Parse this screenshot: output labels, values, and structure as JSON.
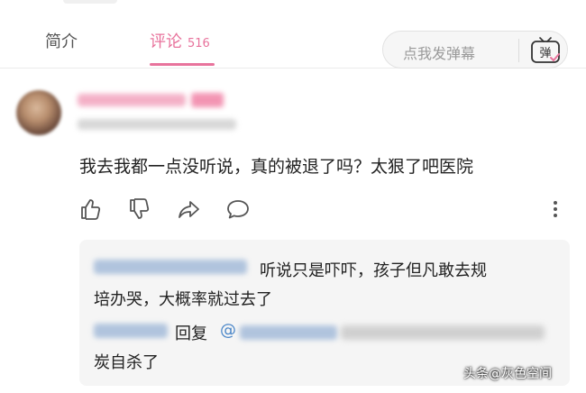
{
  "tabs": {
    "intro_label": "简介",
    "comments_label": "评论",
    "comments_count": "516"
  },
  "danmaku": {
    "placeholder": "点我发弹幕",
    "icon_label": "弹"
  },
  "comment": {
    "text": "我去我都一点没听说，真的被退了吗？太狠了吧医院"
  },
  "replies": {
    "first_line1": "听说只是吓吓，孩子但凡敢去规",
    "first_line2": "培办哭，大概率就过去了",
    "reply_word": "回复",
    "at_symbol": "@",
    "second_line2": "炭自杀了"
  },
  "watermark": "头条@灰色空间",
  "colors": {
    "accent_pink": "#e8739c",
    "link_blue": "#4a86c8",
    "reply_bg": "#f5f5f5"
  },
  "icons": [
    "thumbs-up-icon",
    "thumbs-down-icon",
    "share-icon",
    "reply-bubble-icon",
    "more-vertical-icon",
    "danmaku-tv-icon"
  ]
}
